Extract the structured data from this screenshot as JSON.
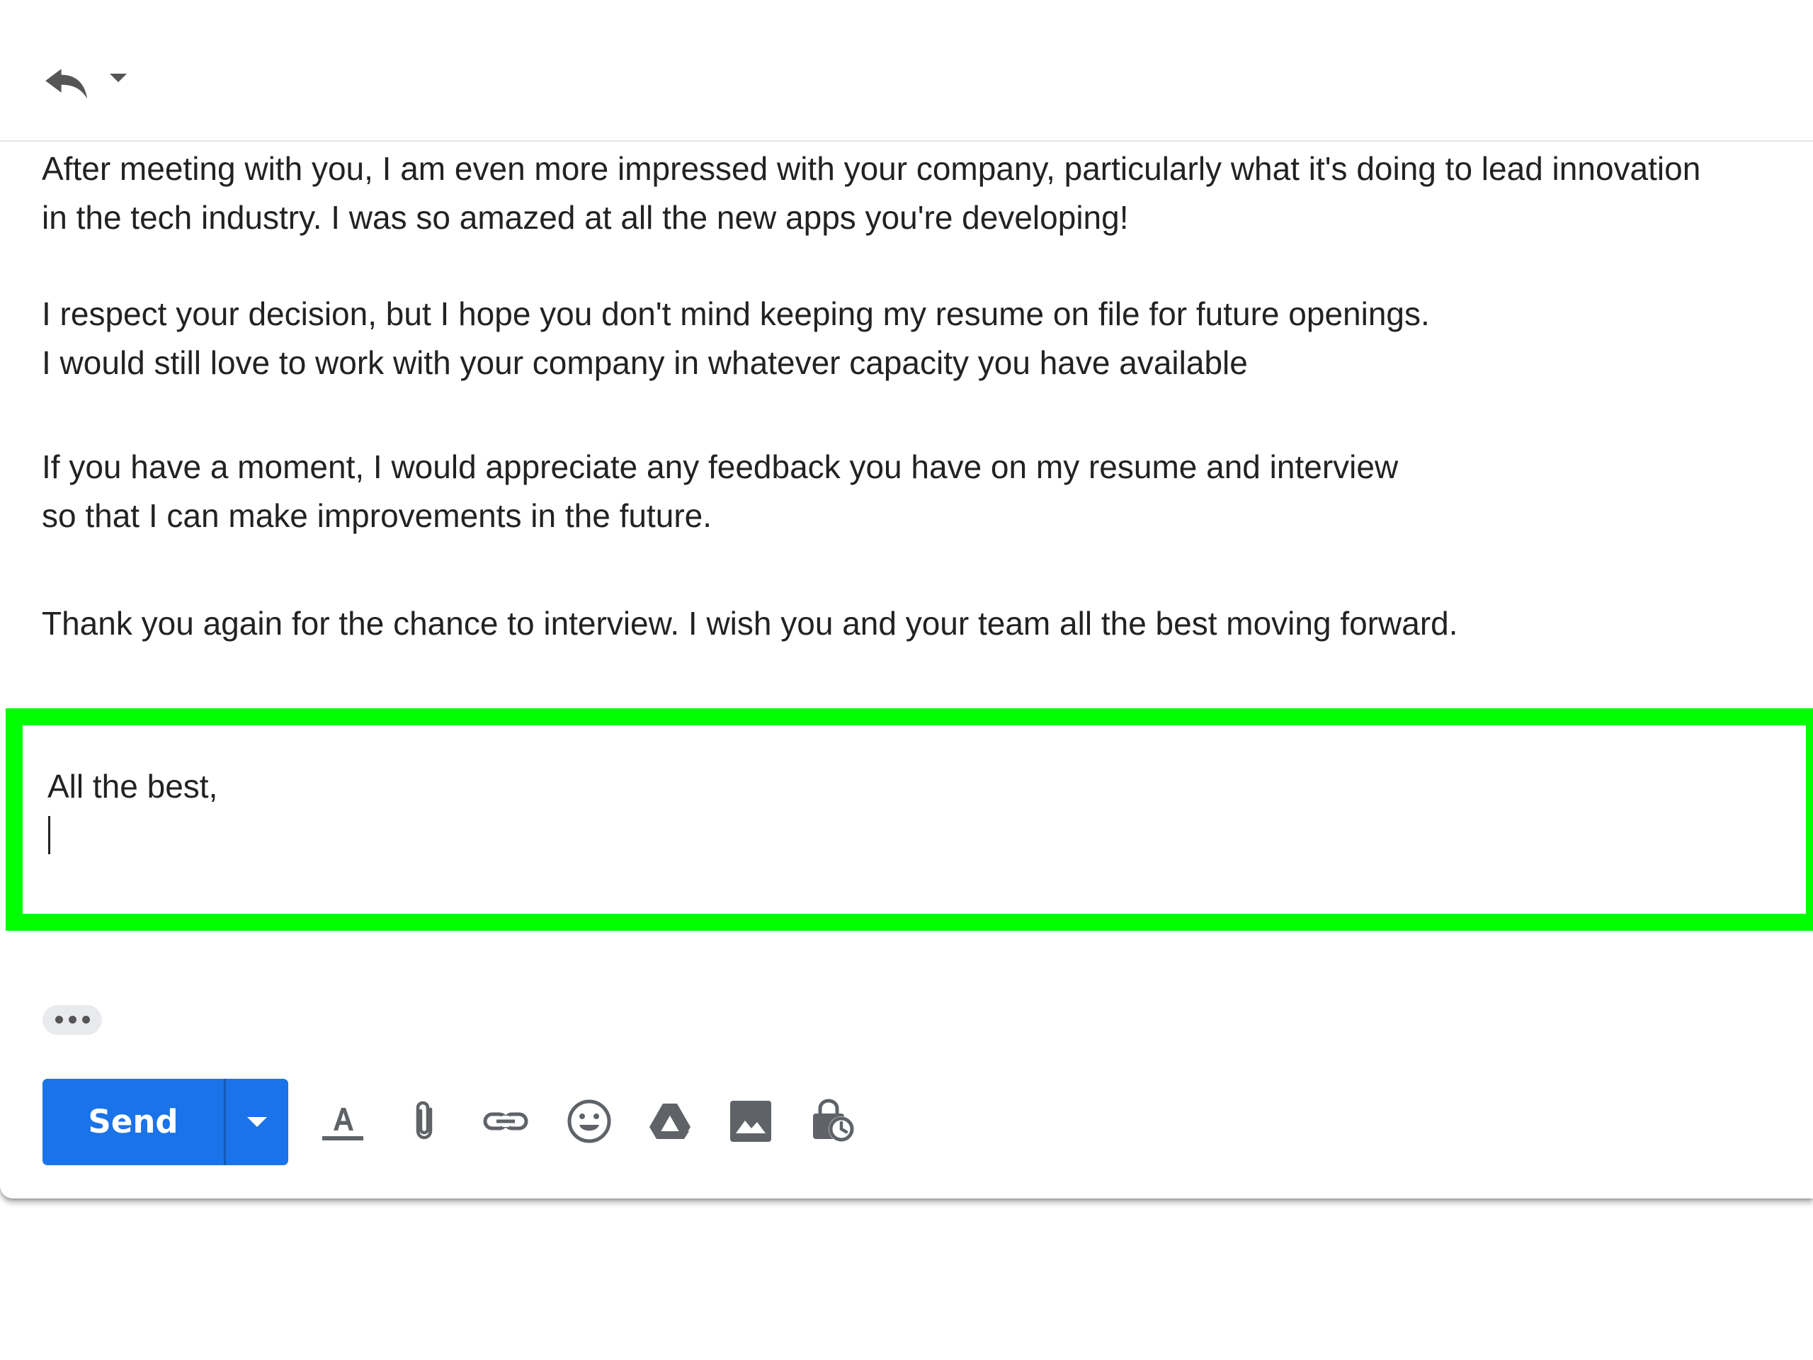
{
  "header": {
    "reply_icon": "reply-icon",
    "reply_options_icon": "caret-down-icon"
  },
  "body": {
    "paragraphs": [
      {
        "lines": [
          "After meeting with you, I am even more impressed with your company, particularly what it's doing to lead innovation",
          "in the tech industry. I was so amazed at all the new apps you're developing!"
        ]
      },
      {
        "lines": [
          "I respect your decision, but I hope you don't mind keeping my resume on file for future openings.",
          "I would still love to work with your company in whatever capacity you have available"
        ]
      },
      {
        "lines": [
          "If you have a moment, I would appreciate any feedback you have on my resume and interview",
          "so that I can make improvements in the future."
        ]
      },
      {
        "lines": [
          "Thank you again for the chance to interview. I wish you and your team all the best moving forward."
        ]
      }
    ]
  },
  "signoff": {
    "text": "All the best,",
    "highlight_color": "#00ff00"
  },
  "toolbar": {
    "send_label": "Send",
    "send_color": "#1a73e8",
    "icons": [
      "formatting-options-icon",
      "attach-files-icon",
      "insert-link-icon",
      "insert-emoji-icon",
      "google-drive-icon",
      "insert-photo-icon",
      "confidential-mode-icon"
    ]
  }
}
